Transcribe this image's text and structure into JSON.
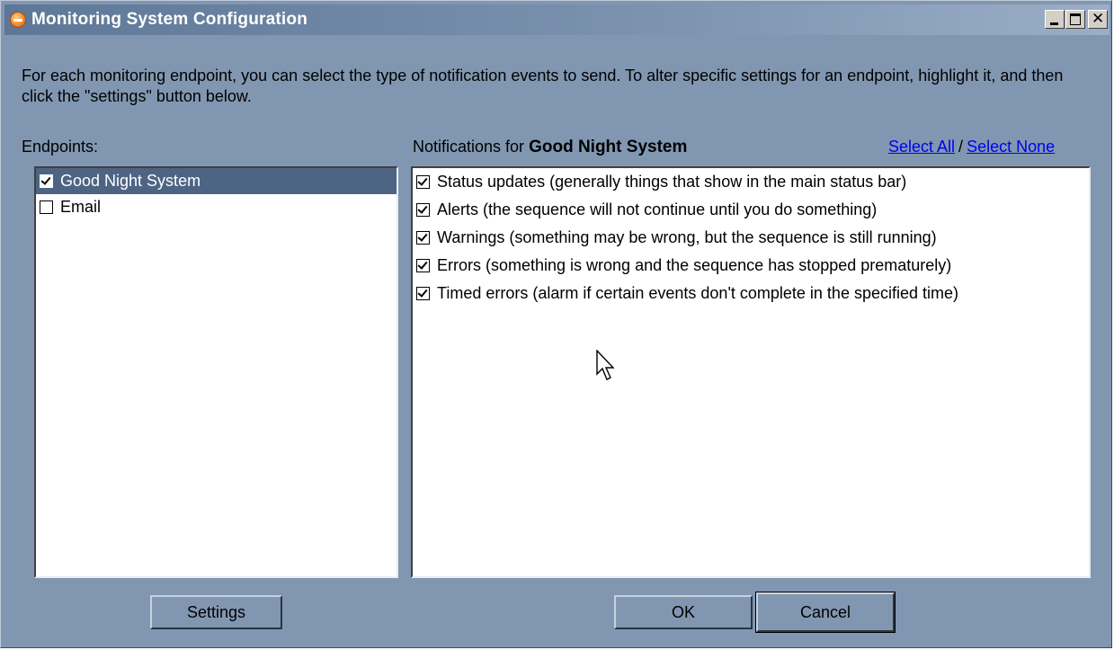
{
  "window": {
    "title": "Monitoring System Configuration"
  },
  "description": "For each monitoring endpoint, you can select the type of notification events to send.  To alter specific settings for an endpoint, highlight it, and then click the \"settings\" button below.",
  "endpoints": {
    "label": "Endpoints:",
    "items": [
      {
        "label": "Good Night System",
        "checked": true,
        "selected": true
      },
      {
        "label": "Email",
        "checked": false,
        "selected": false
      }
    ]
  },
  "notifications": {
    "label_prefix": "Notifications for",
    "selected_endpoint": "Good Night System",
    "select_all": "Select All",
    "separator": "/",
    "select_none": "Select None",
    "items": [
      {
        "label": "Status updates (generally things that show in the main status bar)",
        "checked": true
      },
      {
        "label": "Alerts (the sequence will not continue until you do something)",
        "checked": true
      },
      {
        "label": "Warnings (something may be wrong, but the sequence is still running)",
        "checked": true
      },
      {
        "label": "Errors (something is wrong and the sequence has stopped prematurely)",
        "checked": true
      },
      {
        "label": "Timed errors (alarm if certain events don't complete in the specified time)",
        "checked": true
      }
    ]
  },
  "buttons": {
    "settings": "Settings",
    "ok": "OK",
    "cancel": "Cancel"
  },
  "colors": {
    "window_bg": "#8197b1",
    "title_gradient_start": "#5d7897",
    "selection": "#4d6583",
    "link": "#0000ee"
  },
  "icons": {
    "app": "app-icon",
    "minimize": "minimize-icon",
    "maximize": "maximize-icon",
    "close": "close-icon",
    "cursor": "mouse-pointer-icon"
  }
}
